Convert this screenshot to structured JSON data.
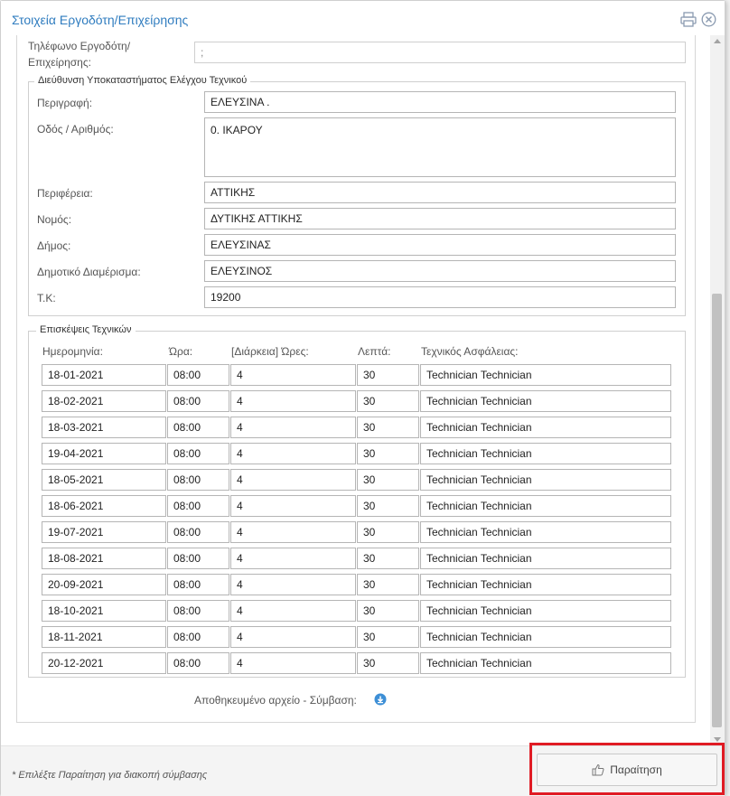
{
  "dialog": {
    "title": "Στοιχεία Εργοδότη/Επιχείρησης",
    "print_icon": "print-icon",
    "close_icon": "close-icon"
  },
  "employer": {
    "phone_label_line1": "Τηλέφωνο Εργοδότη/",
    "phone_label_line2": "Επιχείρησης:",
    "phone_value": ";"
  },
  "branch": {
    "legend": "Διεύθυνση Υποκαταστήματος Ελέγχου Τεχνικού",
    "fields": [
      {
        "label": "Περιγραφή:",
        "value": "ΕΛΕΥΣΙΝΑ ."
      },
      {
        "label": "Οδός / Αριθμός:",
        "value": "0. ΙΚΑΡΟΥ"
      },
      {
        "label": "Περιφέρεια:",
        "value": "ΑΤΤΙΚΗΣ"
      },
      {
        "label": "Νομός:",
        "value": "ΔΥΤΙΚΗΣ ΑΤΤΙΚΗΣ"
      },
      {
        "label": "Δήμος:",
        "value": "ΕΛΕΥΣΙΝΑΣ"
      },
      {
        "label": "Δημοτικό Διαμέρισμα:",
        "value": "ΕΛΕΥΣΙΝΟΣ"
      },
      {
        "label": "Τ.Κ:",
        "value": "19200"
      }
    ]
  },
  "visits": {
    "legend": "Επισκέψεις Τεχνικών",
    "headers": [
      "Ημερομηνία:",
      "Ώρα:",
      "[Διάρκεια] Ώρες:",
      "Λεπτά:",
      "Τεχνικός Ασφάλειας:"
    ],
    "rows": [
      [
        "18-01-2021",
        "08:00",
        "4",
        "30",
        "Technician Technician"
      ],
      [
        "18-02-2021",
        "08:00",
        "4",
        "30",
        "Technician Technician"
      ],
      [
        "18-03-2021",
        "08:00",
        "4",
        "30",
        "Technician Technician"
      ],
      [
        "19-04-2021",
        "08:00",
        "4",
        "30",
        "Technician Technician"
      ],
      [
        "18-05-2021",
        "08:00",
        "4",
        "30",
        "Technician Technician"
      ],
      [
        "18-06-2021",
        "08:00",
        "4",
        "30",
        "Technician Technician"
      ],
      [
        "19-07-2021",
        "08:00",
        "4",
        "30",
        "Technician Technician"
      ],
      [
        "18-08-2021",
        "08:00",
        "4",
        "30",
        "Technician Technician"
      ],
      [
        "20-09-2021",
        "08:00",
        "4",
        "30",
        "Technician Technician"
      ],
      [
        "18-10-2021",
        "08:00",
        "4",
        "30",
        "Technician Technician"
      ],
      [
        "18-11-2021",
        "08:00",
        "4",
        "30",
        "Technician Technician"
      ],
      [
        "20-12-2021",
        "08:00",
        "4",
        "30",
        "Technician Technician"
      ]
    ]
  },
  "contract": {
    "label": "Αποθηκευμένο αρχείο - Σύμβαση:",
    "icon": "download-icon"
  },
  "footer": {
    "note": "* Επιλέξτε Παραίτηση για διακοπή σύμβασης",
    "resign_label": "Παραίτηση",
    "resign_icon": "thumbs-up-icon"
  },
  "colors": {
    "title": "#2f7cbf",
    "highlight": "#e01b24",
    "download_icon": "#3d8fd6"
  }
}
